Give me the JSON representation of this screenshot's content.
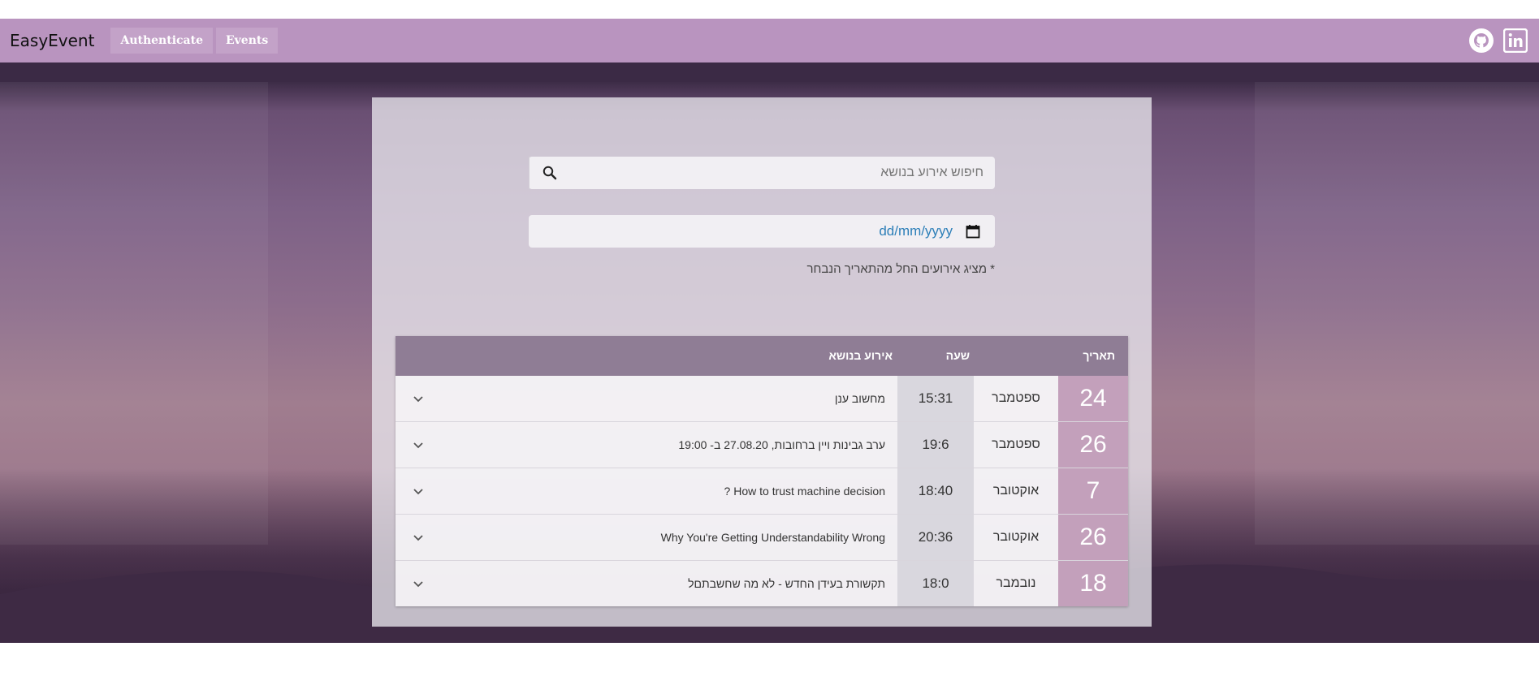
{
  "navbar": {
    "brand": "EasyEvent",
    "links": [
      "Authenticate",
      "Events"
    ],
    "social_icons": [
      "github-icon",
      "linkedin-icon"
    ],
    "color": "#b994bf"
  },
  "search": {
    "placeholder": "חיפוש אירוע בנושא",
    "icon": "search-icon"
  },
  "date_filter": {
    "value": "dd/mm/yyyy",
    "note": "* מציג אירועים החל מהתאריך הנבחר",
    "icon": "calendar-icon"
  },
  "table": {
    "headers": {
      "date": "תאריך",
      "time": "שעה",
      "topic": "אירוע בנושא"
    },
    "rows": [
      {
        "day": "24",
        "month": "ספטמבר",
        "time": "15:31",
        "topic": "מחשוב ענן"
      },
      {
        "day": "26",
        "month": "ספטמבר",
        "time": "19:6",
        "topic": "ערב גבינות ויין ברחובות, 27.08.20 ב- 19:00"
      },
      {
        "day": "7",
        "month": "אוקטובר",
        "time": "18:40",
        "topic": "How to trust machine decision ?"
      },
      {
        "day": "26",
        "month": "אוקטובר",
        "time": "20:36",
        "topic": "Why You're Getting Understandability Wrong"
      },
      {
        "day": "18",
        "month": "נובמבר",
        "time": "18:0",
        "topic": "תקשורת בעידן החדש - לא מה שחשבתםל"
      }
    ],
    "accent": "#c3a0bb"
  }
}
